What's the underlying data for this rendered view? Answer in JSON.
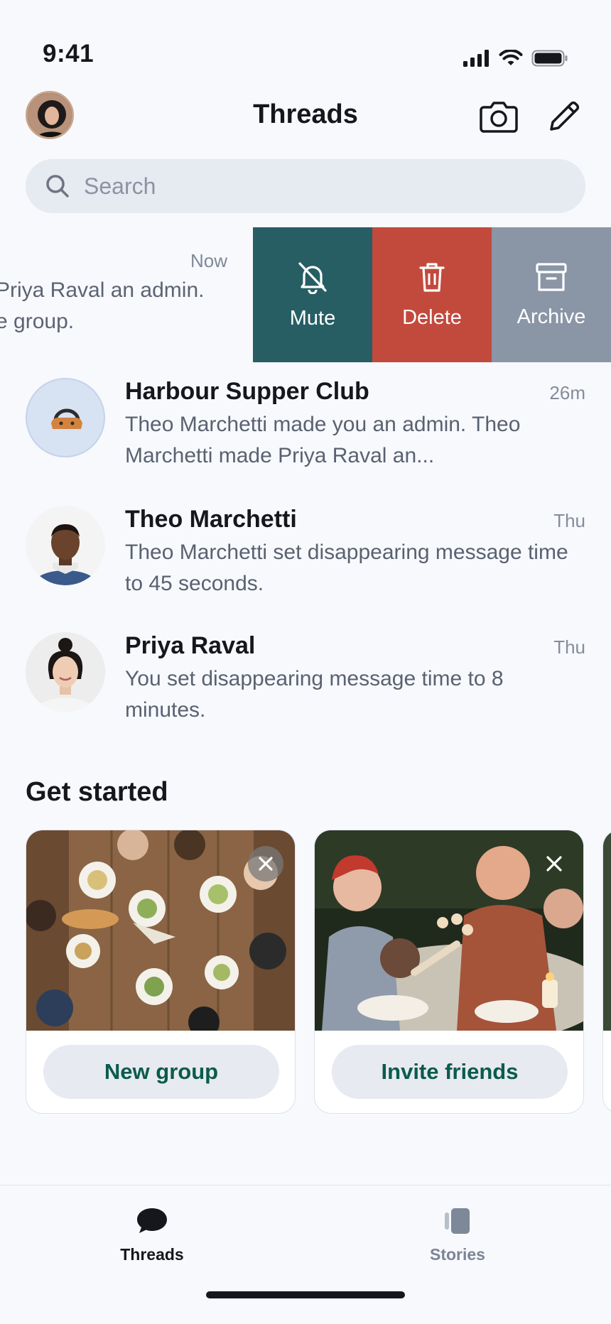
{
  "status_bar": {
    "time": "9:41",
    "icons": [
      "signal-icon",
      "wifi-icon",
      "battery-icon"
    ]
  },
  "header": {
    "title": "Threads",
    "avatar": "profile-avatar",
    "camera_icon": "camera-icon",
    "compose_icon": "pencil-icon"
  },
  "search": {
    "placeholder": "Search",
    "icon": "search-icon"
  },
  "swiped_thread": {
    "time": "Now",
    "line1": "Priya Raval an admin.",
    "line2": "e group.",
    "actions": [
      {
        "label": "Mute",
        "icon": "bell-slash-icon",
        "color": "#265e64"
      },
      {
        "label": "Delete",
        "icon": "trash-icon",
        "color": "#c24a3d"
      },
      {
        "label": "Archive",
        "icon": "archive-icon",
        "color": "#8a95a6"
      }
    ]
  },
  "threads": [
    {
      "name": "Harbour Supper Club",
      "time": "26m",
      "preview": "Theo Marchetti made you an admin. Theo Marchetti made Priya Raval an..."
    },
    {
      "name": "Theo Marchetti",
      "time": "Thu",
      "preview": "Theo Marchetti set disappearing message time to 45 seconds."
    },
    {
      "name": "Priya Raval",
      "time": "Thu",
      "preview": "You set disappearing message time to 8 minutes."
    }
  ],
  "get_started": {
    "title": "Get started",
    "cards": [
      {
        "button": "New group"
      },
      {
        "button": "Invite friends"
      }
    ]
  },
  "tabs": [
    {
      "label": "Threads",
      "icon": "chat-bubble-icon",
      "active": true
    },
    {
      "label": "Stories",
      "icon": "stories-icon",
      "active": false
    }
  ],
  "colors": {
    "accent": "#0b5b4d",
    "background": "#f7f9fd"
  }
}
